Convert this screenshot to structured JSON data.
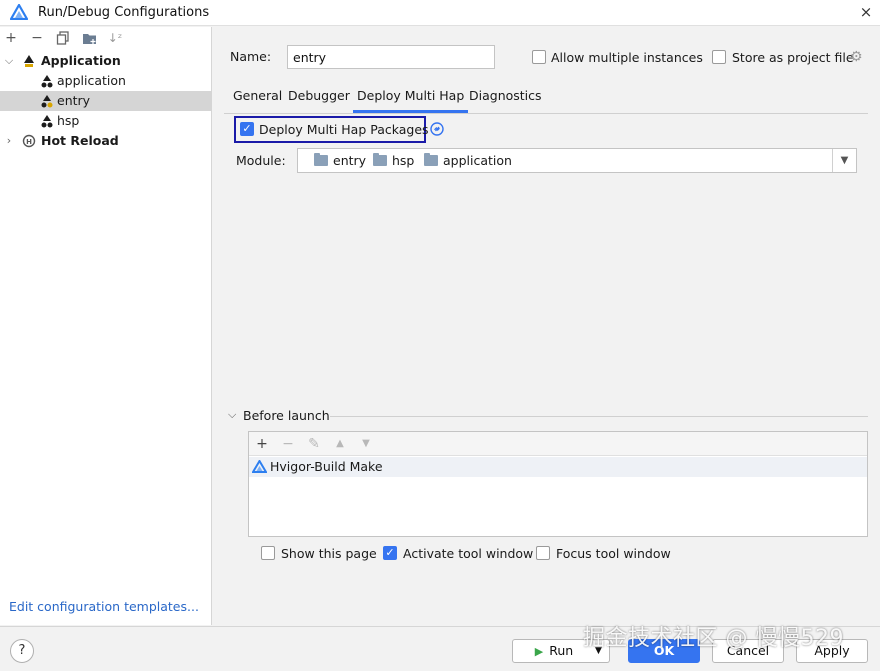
{
  "window": {
    "title": "Run/Debug Configurations",
    "close_icon": "×"
  },
  "sidebar": {
    "toolbar_icons": [
      "plus-icon",
      "minus-icon",
      "copy-icon",
      "folder-icon",
      "sort-icon"
    ],
    "tree": [
      {
        "label": "Application",
        "bold": true,
        "expanded": true
      },
      {
        "label": "application"
      },
      {
        "label": "entry",
        "selected": true
      },
      {
        "label": "hsp"
      },
      {
        "label": "Hot Reload",
        "bold": true,
        "expanded": false
      }
    ],
    "edit_templates": "Edit configuration templates..."
  },
  "config": {
    "name_label": "Name:",
    "name_value": "entry",
    "allow_multiple": "Allow multiple instances",
    "store_as_file": "Store as project file"
  },
  "tabs": [
    {
      "label": "General"
    },
    {
      "label": "Debugger"
    },
    {
      "label": "Deploy Multi Hap",
      "active": true
    },
    {
      "label": "Diagnostics"
    }
  ],
  "deploy": {
    "checkbox_label": "Deploy Multi Hap Packages",
    "checked": true,
    "module_label": "Module:",
    "modules": [
      "entry",
      "hsp",
      "application"
    ]
  },
  "before_launch": {
    "title": "Before launch",
    "items": [
      "Hvigor-Build Make"
    ],
    "show_page": "Show this page",
    "activate_tool": "Activate tool window",
    "focus_tool": "Focus tool window",
    "show_page_checked": false,
    "activate_tool_checked": true,
    "focus_tool_checked": false
  },
  "buttons": {
    "help": "?",
    "run": "Run",
    "ok": "OK",
    "cancel": "Cancel",
    "apply": "Apply"
  },
  "watermark": "掘金技术社区 @ 慢慢529",
  "colors": {
    "accent": "#3574f0",
    "focus_border": "#1a1aa8",
    "link": "#2a68c8"
  }
}
